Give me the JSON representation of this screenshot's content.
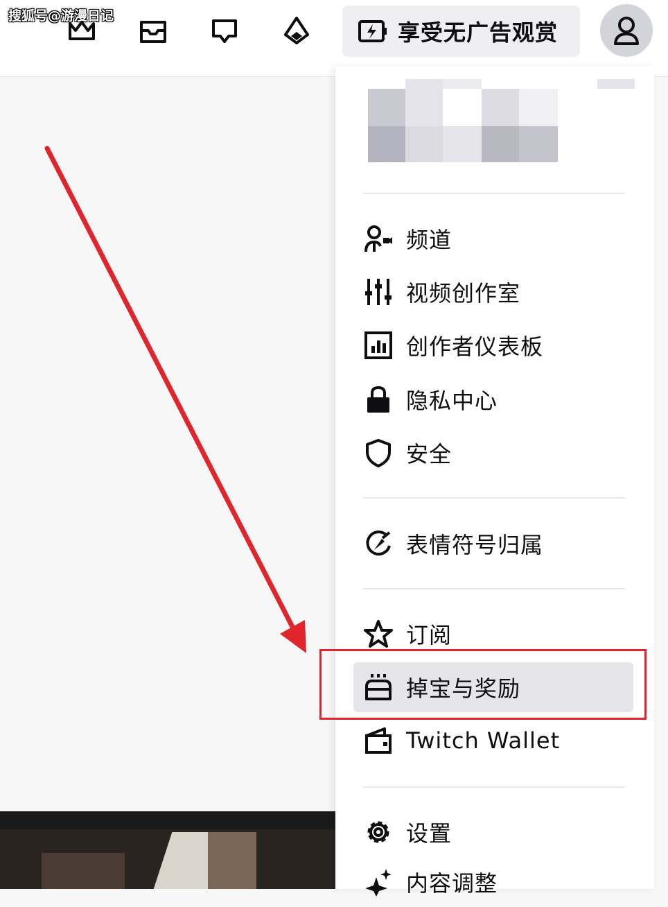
{
  "watermark": "搜狐号@游漫日记",
  "topbar": {
    "icons": [
      "crown-icon",
      "inbox-icon",
      "whispers-icon",
      "bits-icon"
    ],
    "adfree_label": "享受无广告观赏"
  },
  "menu": {
    "items": [
      {
        "label": "频道",
        "icon": "channel-icon"
      },
      {
        "label": "视频创作室",
        "icon": "studio-sliders-icon"
      },
      {
        "label": "创作者仪表板",
        "icon": "dashboard-icon"
      },
      {
        "label": "隐私中心",
        "icon": "lock-icon"
      },
      {
        "label": "安全",
        "icon": "shield-icon"
      },
      {
        "label": "表情符号归属",
        "icon": "emote-icon"
      },
      {
        "label": "订阅",
        "icon": "star-icon"
      },
      {
        "label": "掉宝与奖励",
        "icon": "drops-chest-icon"
      },
      {
        "label": "Twitch Wallet",
        "icon": "wallet-icon"
      },
      {
        "label": "设置",
        "icon": "gear-icon"
      },
      {
        "label": "内容调整",
        "icon": "sparkle-icon"
      }
    ]
  },
  "colors": {
    "annotation_red": "#e0262c",
    "active_item_bg": "#e6e6ea",
    "avatar_bg": "#d3d3da"
  }
}
